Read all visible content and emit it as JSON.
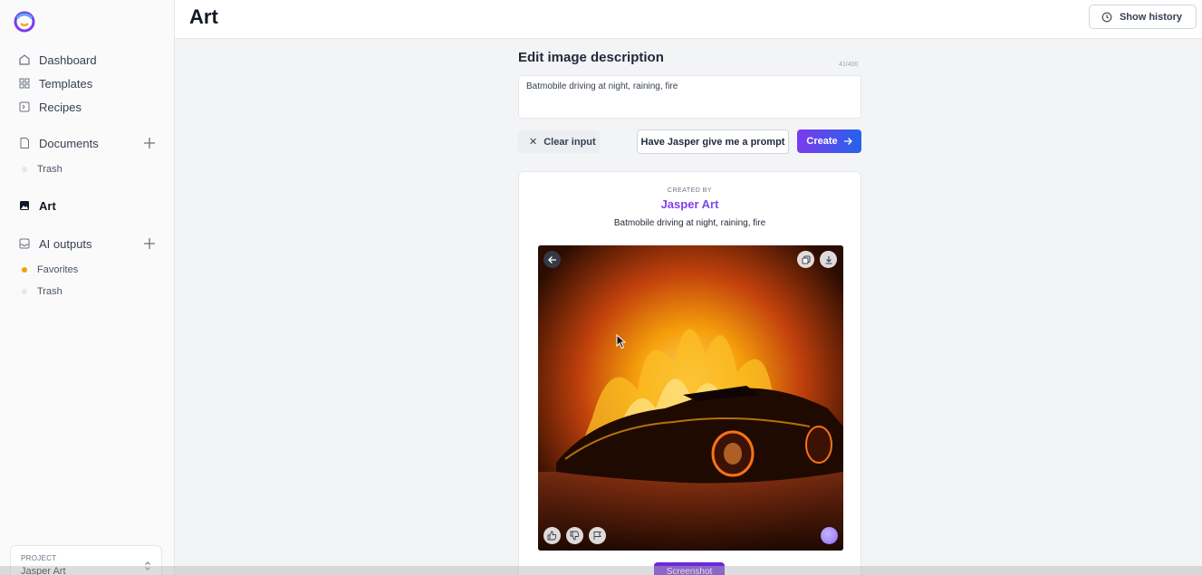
{
  "sidebar": {
    "nav": [
      {
        "label": "Dashboard",
        "icon": "home-icon"
      },
      {
        "label": "Templates",
        "icon": "grid-icon"
      },
      {
        "label": "Recipes",
        "icon": "recipe-icon"
      }
    ],
    "documents": {
      "label": "Documents",
      "sub": [
        {
          "label": "Trash"
        }
      ]
    },
    "art": {
      "label": "Art"
    },
    "ai_outputs": {
      "label": "AI outputs",
      "sub": [
        {
          "label": "Favorites"
        },
        {
          "label": "Trash"
        }
      ]
    },
    "project": {
      "label": "PROJECT",
      "name": "Jasper Art"
    }
  },
  "header": {
    "title": "Art",
    "history_button": "Show history"
  },
  "editor": {
    "title": "Edit image description",
    "char_count": "41/400",
    "input_value": "Batmobile driving at night, raining, fire",
    "clear_button": "Clear input",
    "prompt_button": "Have Jasper give me a prompt",
    "create_button": "Create"
  },
  "result": {
    "created_by": "CREATED BY",
    "author": "Jasper Art",
    "caption": "Batmobile driving at night, raining, fire"
  },
  "screenshot_button": "Screenshot",
  "colors": {
    "accent_start": "#7c3aed",
    "accent_end": "#2563eb"
  }
}
